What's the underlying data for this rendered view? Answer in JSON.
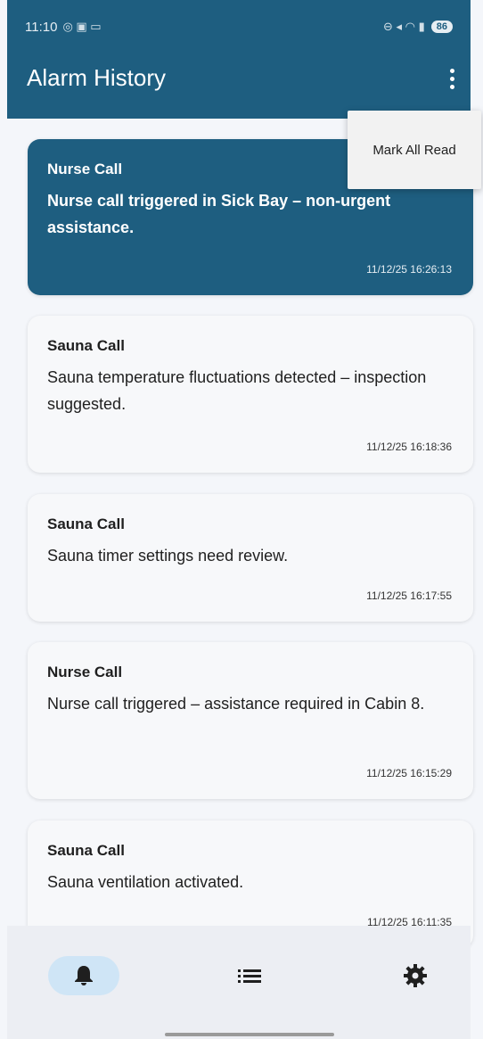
{
  "status_bar": {
    "time": "11:10",
    "battery": "86"
  },
  "app_bar": {
    "title": "Alarm History",
    "menu_icon": "more-vert-icon"
  },
  "menu": {
    "items": [
      {
        "label": "Mark All Read"
      }
    ]
  },
  "alarms": [
    {
      "title": "Nurse Call",
      "message": "Nurse call triggered in Sick Bay – non-urgent assistance.",
      "timestamp": "11/12/25 16:26:13",
      "unread": true
    },
    {
      "title": "Sauna Call",
      "message": "Sauna temperature fluctuations detected – inspection suggested.",
      "timestamp": "11/12/25 16:18:36",
      "unread": false
    },
    {
      "title": "Sauna Call",
      "message": "Sauna timer settings need review.",
      "timestamp": "11/12/25 16:17:55",
      "unread": false
    },
    {
      "title": "Nurse Call",
      "message": "Nurse call triggered – assistance required in Cabin 8.",
      "timestamp": "11/12/25 16:15:29",
      "unread": false
    },
    {
      "title": "Sauna Call",
      "message": "Sauna ventilation activated.",
      "timestamp": "11/12/25 16:11:35",
      "unread": false
    }
  ],
  "bottom_nav": [
    {
      "icon": "bell-icon",
      "active": true
    },
    {
      "icon": "list-icon",
      "active": false
    },
    {
      "icon": "gear-icon",
      "active": false
    }
  ],
  "colors": {
    "primary": "#1e5e80",
    "nav_active": "#cfe5f6"
  }
}
